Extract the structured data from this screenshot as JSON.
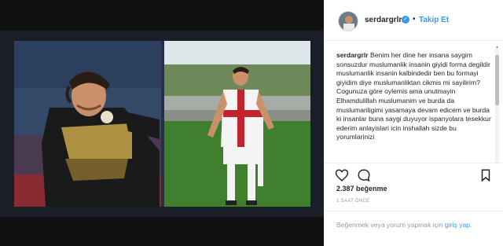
{
  "post": {
    "username": "serdargrlr",
    "follow_label": "Takip Et",
    "caption_user": "serdargrlr",
    "caption_text": "Benim her dine her insana saygim sonsuzdur muslumanlik insanin giyidi forma degildir muslumanlik insanin kalbindedir ben bu formayi giyidim diye muslumanliktan cikmis mi sayilirim? Cogunuza göre oylemis ama unutmayin Elhamdulillah muslumanim ve burda da muslumanligimi yasamaya devam edicem ve burda ki insanlar buna saygi duyuyor ispanyolara tesekkur ederim anlayislari icin inshallah sizde bu yorumlarinizi",
    "likes_count": "2.387",
    "likes_label": "beğenme",
    "time": "1 SAAT ÖNCE",
    "footer_prefix": "Beğenmek veya yorum yapmak için",
    "footer_link": "giriş yap",
    "footer_suffix": "."
  },
  "icons": {
    "verified": "verified-badge-icon",
    "like": "heart-icon",
    "comment": "comment-icon",
    "save": "bookmark-icon"
  },
  "colors": {
    "link": "#3897f0",
    "backdrop": "#111111"
  }
}
